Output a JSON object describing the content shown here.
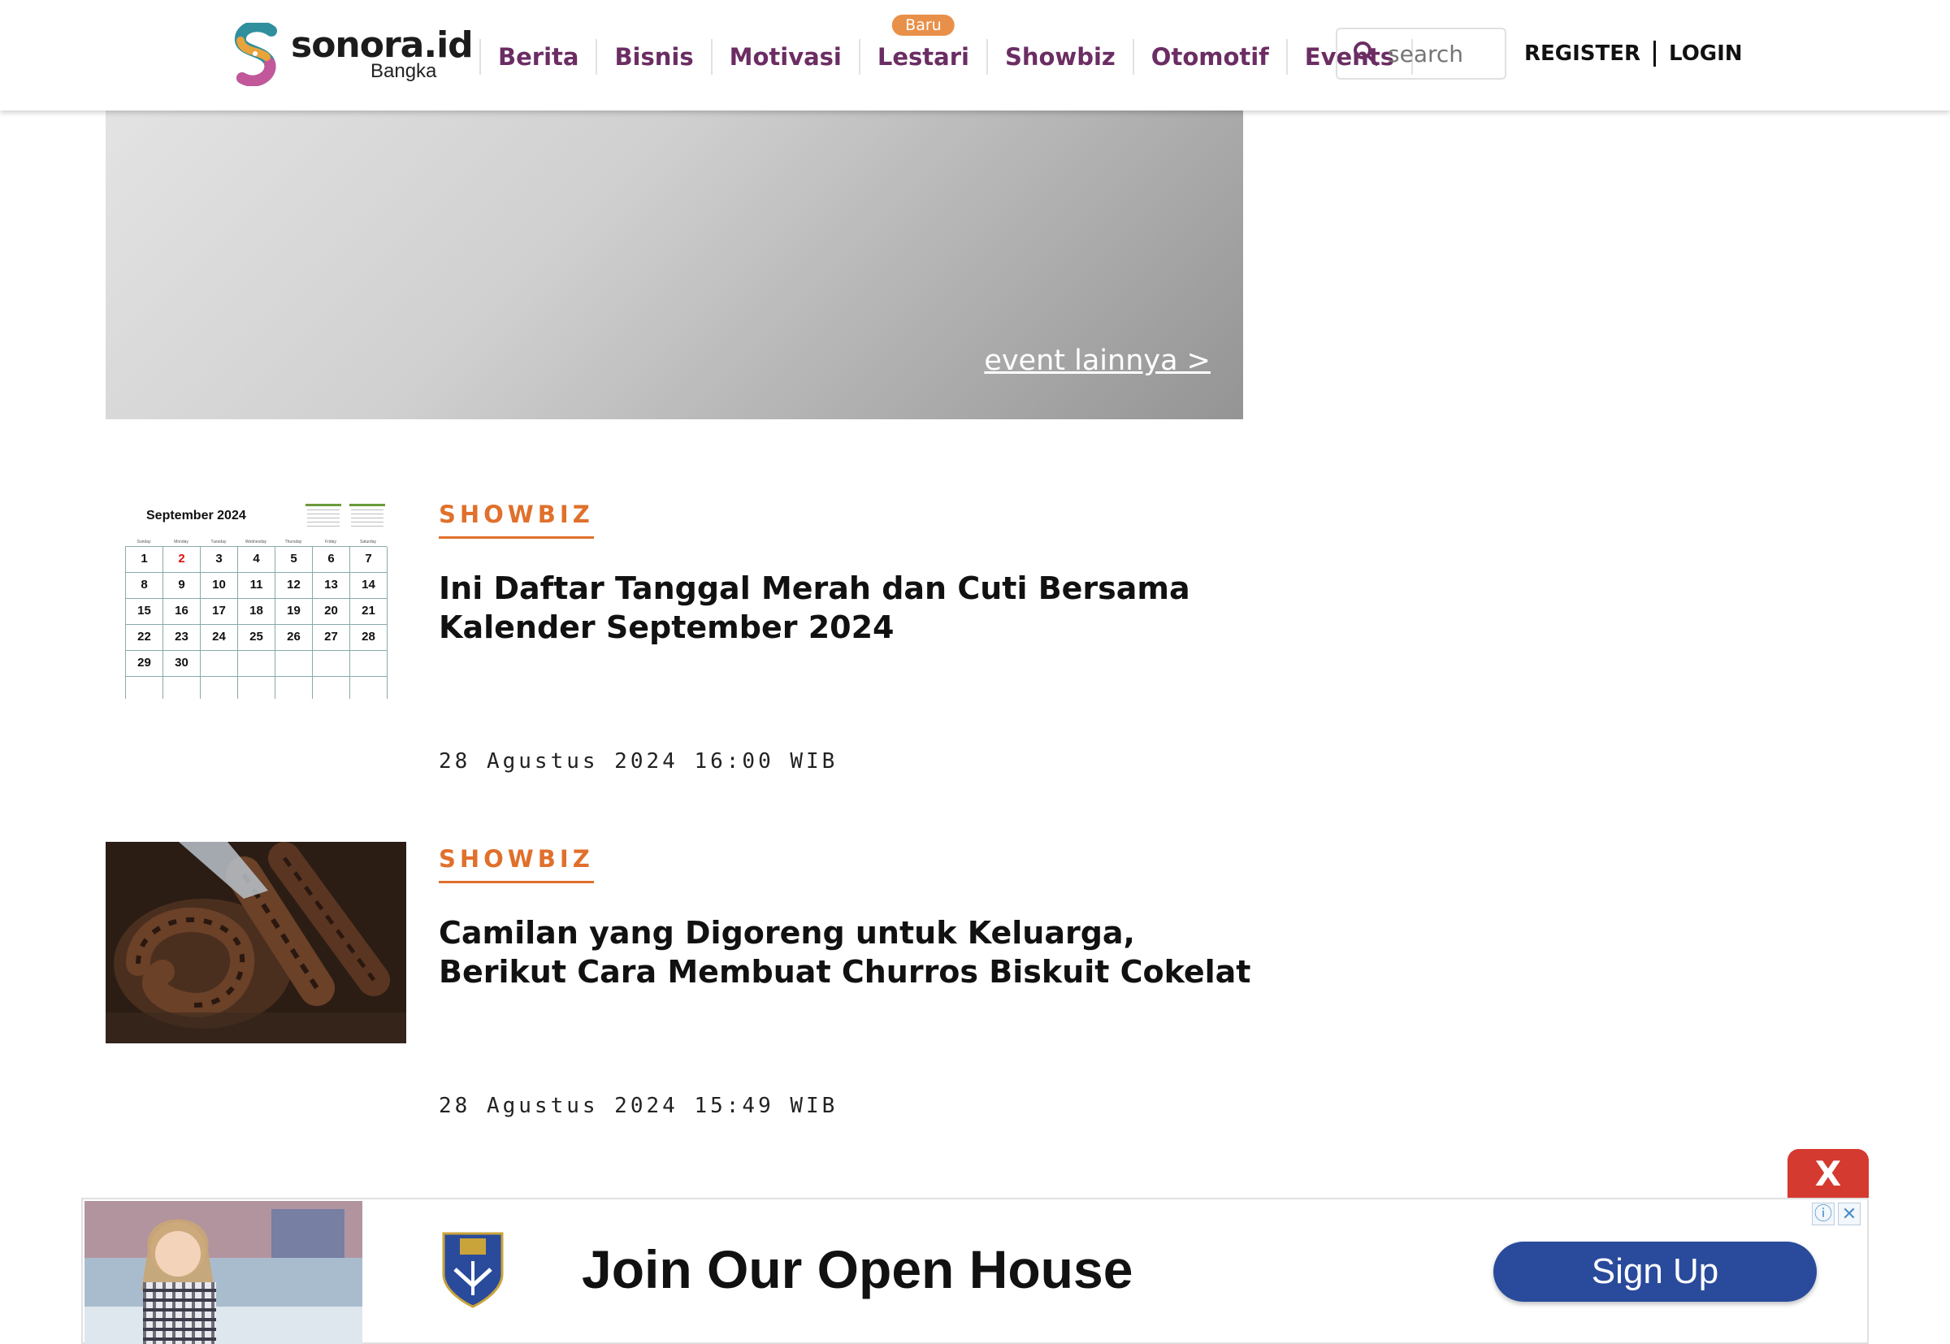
{
  "header": {
    "logo_text": "sonora.id",
    "logo_sub": "Bangka",
    "nav": [
      {
        "label": "Berita"
      },
      {
        "label": "Bisnis"
      },
      {
        "label": "Motivasi"
      },
      {
        "label": "Lestari",
        "badge": "Baru"
      },
      {
        "label": "Showbiz"
      },
      {
        "label": "Otomotif"
      },
      {
        "label": "Events"
      }
    ],
    "search_placeholder": "search",
    "register_label": "REGISTER",
    "login_label": "LOGIN"
  },
  "event_banner": {
    "link_text": "event lainnya >"
  },
  "articles": [
    {
      "category": "SHOWBIZ",
      "title": "Ini Daftar Tanggal Merah dan Cuti Bersama Kalender September 2024",
      "date": "28 Agustus 2024 16:00 WIB",
      "thumbnail": {
        "calendar_title": "September 2024",
        "weekdays": [
          "Sunday",
          "Monday",
          "Tuesday",
          "Wednesday",
          "Thursday",
          "Friday",
          "Saturday"
        ],
        "days": [
          "1",
          "2",
          "3",
          "4",
          "5",
          "6",
          "7",
          "8",
          "9",
          "10",
          "11",
          "12",
          "13",
          "14",
          "15",
          "16",
          "17",
          "18",
          "19",
          "20",
          "21",
          "22",
          "23",
          "24",
          "25",
          "26",
          "27",
          "28",
          "29",
          "30",
          "",
          "",
          "",
          "",
          "",
          "",
          "",
          "",
          "",
          "",
          "",
          ""
        ],
        "highlighted_day": "2"
      }
    },
    {
      "category": "SHOWBIZ",
      "title": "Camilan yang Digoreng untuk Keluarga, Berikut Cara Membuat Churros Biskuit Cokelat",
      "date": "28 Agustus 2024 15:49 WIB"
    }
  ],
  "ad": {
    "close_label": "X",
    "title": "Join Our Open House",
    "button_label": "Sign Up",
    "info_icon": "ⓘ",
    "close_icon": "✕"
  },
  "colors": {
    "nav_text": "#6b2d63",
    "category": "#e0702c",
    "badge": "#e8904a",
    "ad_button": "#2a4b9b",
    "ad_close": "#d43a2f"
  }
}
